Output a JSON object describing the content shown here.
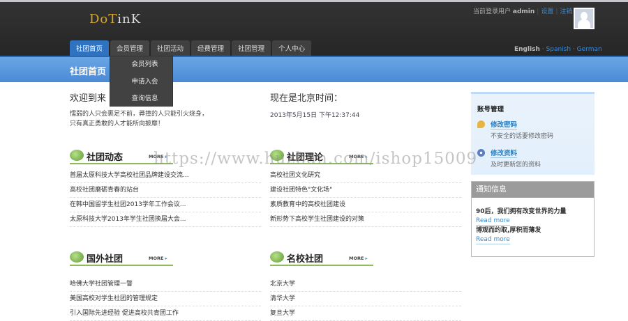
{
  "header": {
    "logo_a": "DoT",
    "logo_b": "inK",
    "user_prefix": "当前登录用户",
    "username": "admin",
    "settings": "设置",
    "logout": "注销",
    "languages": [
      "English",
      "Spanish",
      "German"
    ]
  },
  "nav": {
    "tabs": [
      "社团首页",
      "会员管理",
      "社团活动",
      "经费管理",
      "社团管理",
      "个人中心"
    ],
    "dropdown": [
      "会员列表",
      "申请入会",
      "查询信息"
    ]
  },
  "band_title": "社团首页",
  "welcome": {
    "title": "欢迎到来",
    "line1": "懦弱的人只会裹足不前，莽撞的人只能引火烧身，",
    "line2": "只有真正勇敢的人才能所向披靡！"
  },
  "time": {
    "title": "现在是北京时间：",
    "value": "2013年5月15日 下午12:37:44"
  },
  "sections": [
    {
      "title": "社团动态",
      "more": "MORE",
      "items": [
        "首届太原科技大学高校社团品牌建设交流...",
        "高校社团磨砺青春的站台",
        "在韩中国留学生社团2013学年工作会议...",
        "太原科技大学2013年学生社团换届大会..."
      ]
    },
    {
      "title": "社团理论",
      "more": "MORE",
      "items": [
        "高校社团文化研究",
        "建设社团特色\"文化场\"",
        "素质教育中的高校社团建设",
        "新形势下高校学生社团建设的对策"
      ]
    },
    {
      "title": "国外社团",
      "more": "MORE",
      "items": [
        "哈佛大学社团管理一瞥",
        "美国高校对学生社团的管理规定",
        "引入国际先进经验 促进高校共青团工作"
      ]
    },
    {
      "title": "名校社团",
      "more": "MORE",
      "items": [
        "北京大学",
        "清华大学",
        "复旦大学"
      ]
    }
  ],
  "account": {
    "title": "账号管理",
    "items": [
      {
        "link": "修改密码",
        "desc": "不安全的话要修改密码"
      },
      {
        "link": "修改资料",
        "desc": "及时更新您的资料"
      }
    ]
  },
  "notice": {
    "title": "通知信息",
    "items": [
      {
        "title": "90后，我们拥有改变世界的力量",
        "link": "Read more"
      },
      {
        "title": "博观而约取,厚积而薄发",
        "link": "Read more"
      }
    ]
  },
  "watermark": "https://www.huzhan.com/ishop15009"
}
